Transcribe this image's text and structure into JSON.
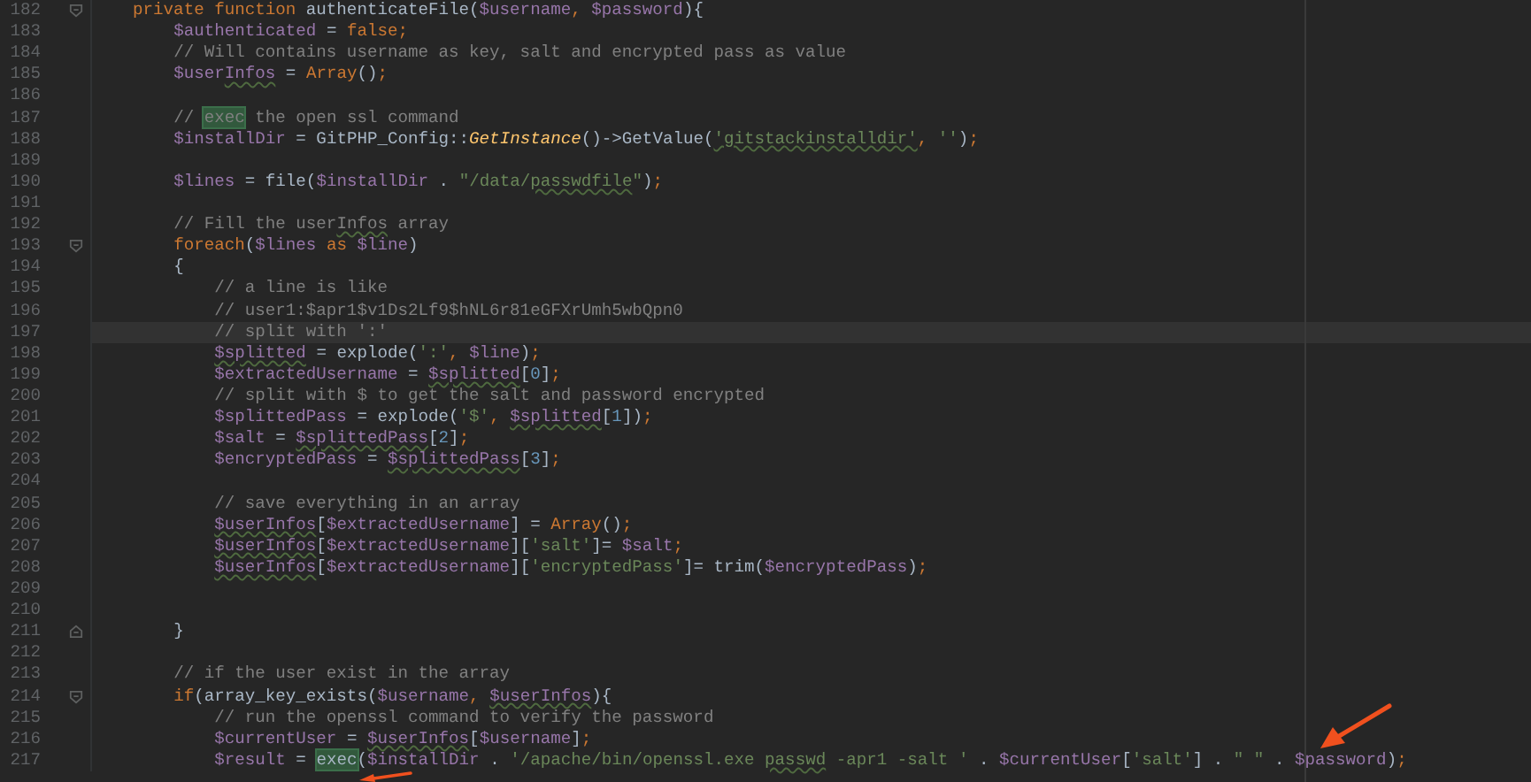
{
  "editor": {
    "lines": [
      {
        "number": "182",
        "fold_start": true,
        "current": false,
        "tokens": [
          {
            "text": "    private function ",
            "kind": "keyword"
          },
          {
            "text": "authenticateFile(",
            "kind": "plain"
          },
          {
            "text": "$username",
            "kind": "variable"
          },
          {
            "text": ", ",
            "kind": "keyword"
          },
          {
            "text": "$password",
            "kind": "variable"
          },
          {
            "text": "){",
            "kind": "plain"
          }
        ]
      },
      {
        "number": "183",
        "current": false,
        "tokens": [
          {
            "text": "        $authenticated",
            "kind": "variable"
          },
          {
            "text": " = ",
            "kind": "plain"
          },
          {
            "text": "false",
            "kind": "keyword"
          },
          {
            "text": ";",
            "kind": "keyword"
          }
        ]
      },
      {
        "number": "184",
        "current": false,
        "tokens": [
          {
            "text": "        // Will contains username as key, salt and encrypted pass as value",
            "kind": "comment"
          }
        ]
      },
      {
        "number": "185",
        "current": false,
        "tokens": [
          {
            "text": "        $user",
            "kind": "variable"
          },
          {
            "text": "Infos",
            "kind": "variable",
            "squiggle": true
          },
          {
            "text": " = ",
            "kind": "plain"
          },
          {
            "text": "Array",
            "kind": "keyword"
          },
          {
            "text": "()",
            "kind": "plain"
          },
          {
            "text": ";",
            "kind": "keyword"
          }
        ]
      },
      {
        "number": "186",
        "current": false
      },
      {
        "number": "187",
        "current": false,
        "tokens": [
          {
            "text": "        // ",
            "kind": "comment"
          },
          {
            "text": "exec",
            "kind": "comment",
            "match": true
          },
          {
            "text": " the open ssl command",
            "kind": "comment"
          }
        ]
      },
      {
        "number": "188",
        "current": false,
        "tokens": [
          {
            "text": "        $installDir",
            "kind": "variable"
          },
          {
            "text": " = GitPHP_Config::",
            "kind": "plain"
          },
          {
            "text": "GetInstance",
            "kind": "method"
          },
          {
            "text": "()->GetValue(",
            "kind": "plain"
          },
          {
            "text": "'gitstackinstalldir'",
            "kind": "string",
            "squiggle": true
          },
          {
            "text": ", ",
            "kind": "keyword"
          },
          {
            "text": "''",
            "kind": "string"
          },
          {
            "text": ")",
            "kind": "plain"
          },
          {
            "text": ";",
            "kind": "keyword"
          }
        ]
      },
      {
        "number": "189",
        "current": false
      },
      {
        "number": "190",
        "current": false,
        "tokens": [
          {
            "text": "        $lines",
            "kind": "variable"
          },
          {
            "text": " = file(",
            "kind": "plain"
          },
          {
            "text": "$installDir",
            "kind": "variable"
          },
          {
            "text": " . ",
            "kind": "plain"
          },
          {
            "text": "\"/data/",
            "kind": "string"
          },
          {
            "text": "passwdfile",
            "kind": "string",
            "squiggle": true
          },
          {
            "text": "\"",
            "kind": "string"
          },
          {
            "text": ")",
            "kind": "plain"
          },
          {
            "text": ";",
            "kind": "keyword"
          }
        ]
      },
      {
        "number": "191",
        "current": false
      },
      {
        "number": "192",
        "current": false,
        "tokens": [
          {
            "text": "        // Fill the user",
            "kind": "comment"
          },
          {
            "text": "Infos",
            "kind": "comment",
            "squiggle": true
          },
          {
            "text": " array",
            "kind": "comment"
          }
        ]
      },
      {
        "number": "193",
        "fold_start": true,
        "current": false,
        "tokens": [
          {
            "text": "        foreach",
            "kind": "keyword"
          },
          {
            "text": "(",
            "kind": "plain"
          },
          {
            "text": "$lines",
            "kind": "variable"
          },
          {
            "text": " as ",
            "kind": "keyword"
          },
          {
            "text": "$line",
            "kind": "variable"
          },
          {
            "text": ")",
            "kind": "plain"
          }
        ]
      },
      {
        "number": "194",
        "current": false,
        "tokens": [
          {
            "text": "        {",
            "kind": "plain"
          }
        ]
      },
      {
        "number": "195",
        "current": false,
        "tokens": [
          {
            "text": "            // a line is like",
            "kind": "comment"
          }
        ]
      },
      {
        "number": "196",
        "current": false,
        "tokens": [
          {
            "text": "            // user1:$apr1$v1Ds2Lf9$hNL6r81eGFXrUmh5wbQpn0",
            "kind": "comment"
          }
        ]
      },
      {
        "number": "197",
        "current": true,
        "tokens": [
          {
            "text": "            // split with ':'",
            "kind": "comment"
          }
        ]
      },
      {
        "number": "198",
        "current": false,
        "tokens": [
          {
            "text": "            $splitted",
            "kind": "variable",
            "squiggle": true
          },
          {
            "text": " = explode(",
            "kind": "plain"
          },
          {
            "text": "':'",
            "kind": "string"
          },
          {
            "text": ", ",
            "kind": "keyword"
          },
          {
            "text": "$line",
            "kind": "variable"
          },
          {
            "text": ")",
            "kind": "plain"
          },
          {
            "text": ";",
            "kind": "keyword"
          }
        ]
      },
      {
        "number": "199",
        "current": false,
        "tokens": [
          {
            "text": "            $extractedUsername",
            "kind": "variable"
          },
          {
            "text": " = ",
            "kind": "plain"
          },
          {
            "text": "$splitted",
            "kind": "variable",
            "squiggle": true
          },
          {
            "text": "[",
            "kind": "plain"
          },
          {
            "text": "0",
            "kind": "number"
          },
          {
            "text": "]",
            "kind": "plain"
          },
          {
            "text": ";",
            "kind": "keyword"
          }
        ]
      },
      {
        "number": "200",
        "current": false,
        "tokens": [
          {
            "text": "            // split with $ to get the salt and password encrypted",
            "kind": "comment"
          }
        ]
      },
      {
        "number": "201",
        "current": false,
        "tokens": [
          {
            "text": "            $splittedPass",
            "kind": "variable"
          },
          {
            "text": " = explode(",
            "kind": "plain"
          },
          {
            "text": "'$'",
            "kind": "string"
          },
          {
            "text": ", ",
            "kind": "keyword"
          },
          {
            "text": "$splitted",
            "kind": "variable",
            "squiggle": true
          },
          {
            "text": "[",
            "kind": "plain"
          },
          {
            "text": "1",
            "kind": "number"
          },
          {
            "text": "])",
            "kind": "plain"
          },
          {
            "text": ";",
            "kind": "keyword"
          }
        ]
      },
      {
        "number": "202",
        "current": false,
        "tokens": [
          {
            "text": "            $salt",
            "kind": "variable"
          },
          {
            "text": " = ",
            "kind": "plain"
          },
          {
            "text": "$splittedPass",
            "kind": "variable",
            "squiggle": true
          },
          {
            "text": "[",
            "kind": "plain"
          },
          {
            "text": "2",
            "kind": "number"
          },
          {
            "text": "]",
            "kind": "plain"
          },
          {
            "text": ";",
            "kind": "keyword"
          }
        ]
      },
      {
        "number": "203",
        "current": false,
        "tokens": [
          {
            "text": "            $encryptedPass",
            "kind": "variable"
          },
          {
            "text": " = ",
            "kind": "plain"
          },
          {
            "text": "$splittedPass",
            "kind": "variable",
            "squiggle": true
          },
          {
            "text": "[",
            "kind": "plain"
          },
          {
            "text": "3",
            "kind": "number"
          },
          {
            "text": "]",
            "kind": "plain"
          },
          {
            "text": ";",
            "kind": "keyword"
          }
        ]
      },
      {
        "number": "204",
        "current": false
      },
      {
        "number": "205",
        "current": false,
        "tokens": [
          {
            "text": "            // save everything in an array",
            "kind": "comment"
          }
        ]
      },
      {
        "number": "206",
        "current": false,
        "tokens": [
          {
            "text": "            $userInfos",
            "kind": "variable",
            "squiggle": true
          },
          {
            "text": "[",
            "kind": "plain"
          },
          {
            "text": "$extractedUsername",
            "kind": "variable"
          },
          {
            "text": "] = ",
            "kind": "plain"
          },
          {
            "text": "Array",
            "kind": "keyword"
          },
          {
            "text": "()",
            "kind": "plain"
          },
          {
            "text": ";",
            "kind": "keyword"
          }
        ]
      },
      {
        "number": "207",
        "current": false,
        "tokens": [
          {
            "text": "            $userInfos",
            "kind": "variable",
            "squiggle": true
          },
          {
            "text": "[",
            "kind": "plain"
          },
          {
            "text": "$extractedUsername",
            "kind": "variable"
          },
          {
            "text": "][",
            "kind": "plain"
          },
          {
            "text": "'salt'",
            "kind": "string"
          },
          {
            "text": "]= ",
            "kind": "plain"
          },
          {
            "text": "$salt",
            "kind": "variable"
          },
          {
            "text": ";",
            "kind": "keyword"
          }
        ]
      },
      {
        "number": "208",
        "current": false,
        "tokens": [
          {
            "text": "            $userInfos",
            "kind": "variable",
            "squiggle": true
          },
          {
            "text": "[",
            "kind": "plain"
          },
          {
            "text": "$extractedUsername",
            "kind": "variable"
          },
          {
            "text": "][",
            "kind": "plain"
          },
          {
            "text": "'encryptedPass'",
            "kind": "string"
          },
          {
            "text": "]= trim(",
            "kind": "plain"
          },
          {
            "text": "$encryptedPass",
            "kind": "variable"
          },
          {
            "text": ")",
            "kind": "plain"
          },
          {
            "text": ";",
            "kind": "keyword"
          }
        ]
      },
      {
        "number": "209",
        "current": false
      },
      {
        "number": "210",
        "current": false
      },
      {
        "number": "211",
        "fold_end": true,
        "current": false,
        "tokens": [
          {
            "text": "        }",
            "kind": "plain"
          }
        ]
      },
      {
        "number": "212",
        "current": false
      },
      {
        "number": "213",
        "current": false,
        "tokens": [
          {
            "text": "        // if the user exist in the array",
            "kind": "comment"
          }
        ]
      },
      {
        "number": "214",
        "fold_start": true,
        "current": false,
        "tokens": [
          {
            "text": "        if",
            "kind": "keyword"
          },
          {
            "text": "(array_key_exists(",
            "kind": "plain"
          },
          {
            "text": "$username",
            "kind": "variable"
          },
          {
            "text": ", ",
            "kind": "keyword"
          },
          {
            "text": "$userInfos",
            "kind": "variable",
            "squiggle": true
          },
          {
            "text": "){",
            "kind": "plain"
          }
        ]
      },
      {
        "number": "215",
        "current": false,
        "tokens": [
          {
            "text": "            // run the openssl command to verify the password",
            "kind": "comment"
          }
        ]
      },
      {
        "number": "216",
        "current": false,
        "tokens": [
          {
            "text": "            $currentUser",
            "kind": "variable"
          },
          {
            "text": " = ",
            "kind": "plain"
          },
          {
            "text": "$userInfos",
            "kind": "variable",
            "squiggle": true
          },
          {
            "text": "[",
            "kind": "plain"
          },
          {
            "text": "$username",
            "kind": "variable"
          },
          {
            "text": "]",
            "kind": "plain"
          },
          {
            "text": ";",
            "kind": "keyword"
          }
        ]
      },
      {
        "number": "217",
        "current": false,
        "tokens": [
          {
            "text": "            $result",
            "kind": "variable"
          },
          {
            "text": " = ",
            "kind": "plain"
          },
          {
            "text": "exec",
            "kind": "plain",
            "match": true
          },
          {
            "text": "(",
            "kind": "plain"
          },
          {
            "text": "$installDir",
            "kind": "variable"
          },
          {
            "text": " . ",
            "kind": "plain"
          },
          {
            "text": "'/apache/bin/openssl.exe ",
            "kind": "string"
          },
          {
            "text": "passwd",
            "kind": "string",
            "squiggle": true
          },
          {
            "text": " -apr1 -salt '",
            "kind": "string"
          },
          {
            "text": " . ",
            "kind": "plain"
          },
          {
            "text": "$currentUser",
            "kind": "variable"
          },
          {
            "text": "[",
            "kind": "plain"
          },
          {
            "text": "'salt'",
            "kind": "string"
          },
          {
            "text": "] . ",
            "kind": "plain"
          },
          {
            "text": "\" \"",
            "kind": "string"
          },
          {
            "text": " . ",
            "kind": "plain"
          },
          {
            "text": "$password",
            "kind": "variable"
          },
          {
            "text": ")",
            "kind": "plain"
          },
          {
            "text": ";",
            "kind": "keyword"
          }
        ]
      }
    ]
  }
}
